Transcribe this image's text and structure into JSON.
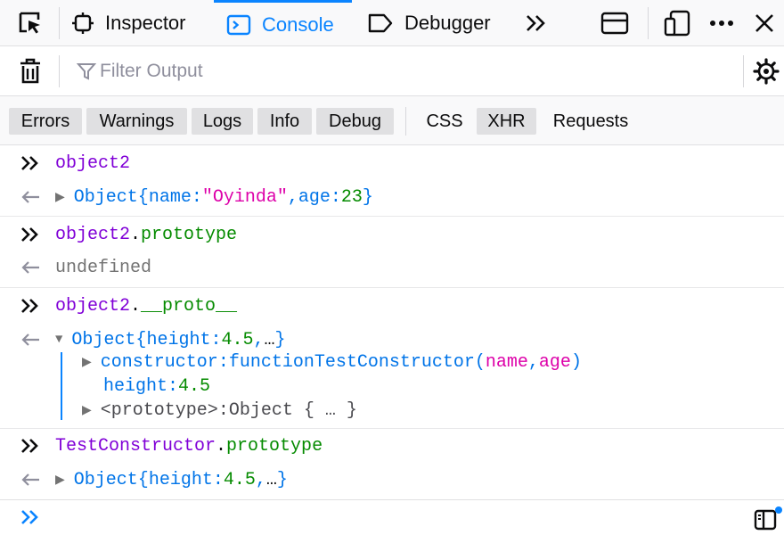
{
  "toolbar": {
    "tabs": [
      {
        "label": "Inspector",
        "icon": "inspector-icon"
      },
      {
        "label": "Console",
        "icon": "console-icon"
      },
      {
        "label": "Debugger",
        "icon": "debugger-icon"
      }
    ],
    "active_tab": "Console",
    "accent_color": "#0a84ff"
  },
  "filter": {
    "placeholder": "Filter Output"
  },
  "categories": {
    "levels": [
      "Errors",
      "Warnings",
      "Logs",
      "Info",
      "Debug"
    ],
    "types": [
      "CSS",
      "XHR",
      "Requests"
    ],
    "enabled": [
      "Errors",
      "Warnings",
      "Logs",
      "Info",
      "Debug",
      "XHR"
    ]
  },
  "console": {
    "entries": [
      {
        "input": [
          "object2"
        ],
        "result": {
          "label": "Object",
          "open": "{",
          "k1": "name",
          "colon1": ":",
          "v1": "\"Oyinda\"",
          "comma": ",",
          "k2": "age",
          "colon2": ":",
          "v2": "23",
          "close": "}"
        }
      },
      {
        "input": [
          "object2",
          ".",
          "prototype"
        ],
        "result_text": "undefined"
      },
      {
        "input": [
          "object2",
          ".",
          "__proto__"
        ],
        "result": {
          "label": "Object",
          "open": "{",
          "k1": "height",
          "colon1": ":",
          "v1": "4.5",
          "comma": ",",
          "more": "…",
          "close": "}"
        },
        "children": [
          {
            "key": "constructor",
            "colon": ":",
            "fn_kw": "function",
            "fn_name": "TestConstructor",
            "paren_open": "(",
            "param1": "name",
            "sep": ",",
            "param2": "age",
            "paren_close": ")"
          },
          {
            "key": "height",
            "colon": ":",
            "value": "4.5"
          },
          {
            "key": "<prototype>",
            "colon": ":",
            "value": "Object { … }"
          }
        ]
      },
      {
        "input": [
          "TestConstructor",
          ".",
          "prototype"
        ],
        "result": {
          "label": "Object",
          "open": "{",
          "k1": "height",
          "colon1": ":",
          "v1": "4.5",
          "comma": ",",
          "more": "…",
          "close": "}"
        }
      }
    ]
  }
}
